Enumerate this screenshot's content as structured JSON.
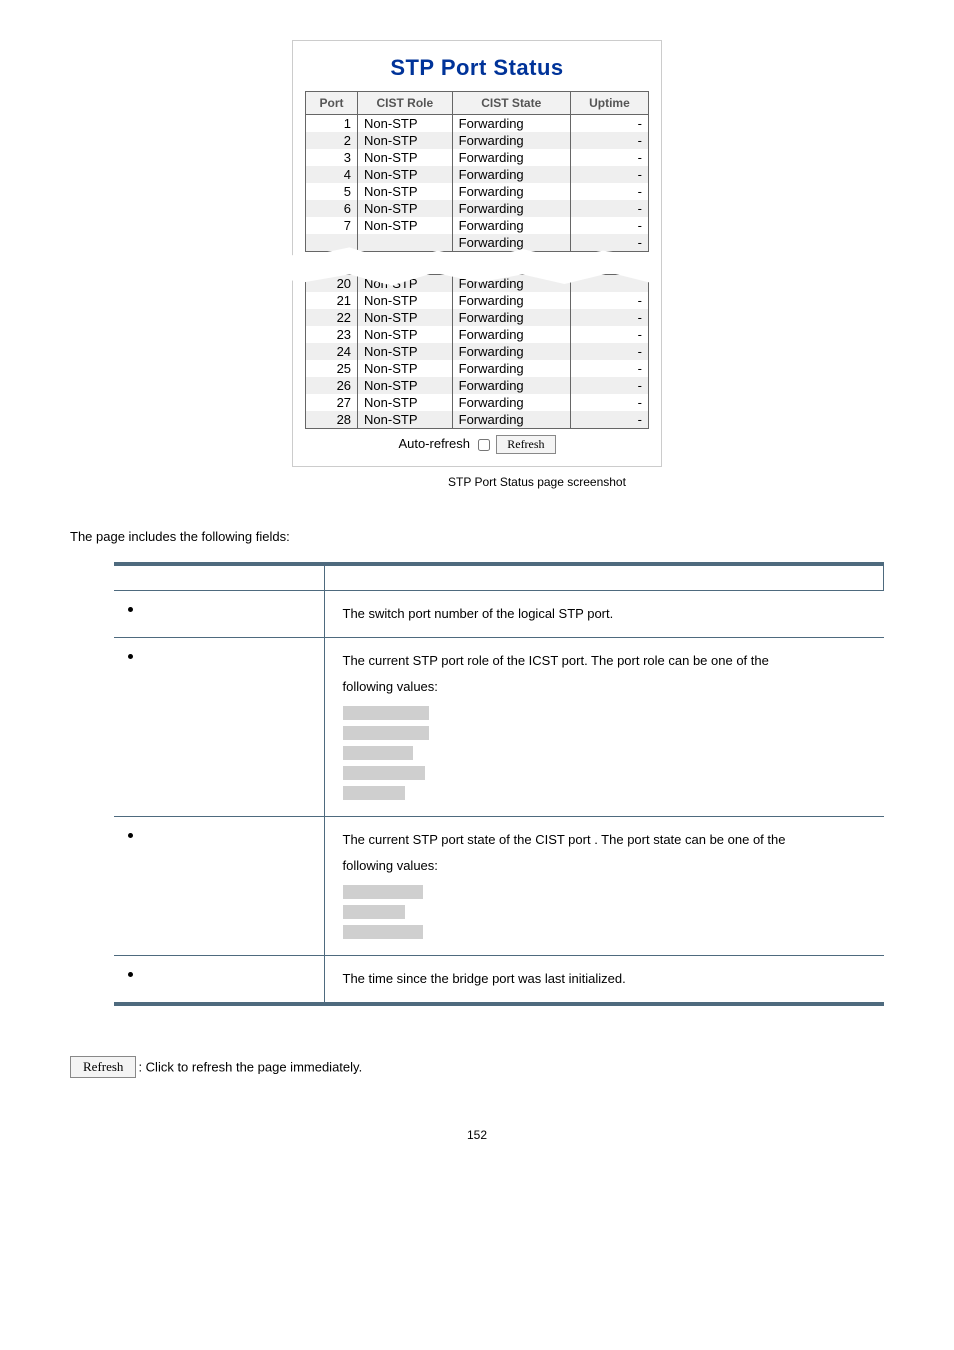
{
  "stp_panel": {
    "title": "STP Port Status",
    "headers": {
      "port": "Port",
      "cist_role": "CIST Role",
      "cist_state": "CIST State",
      "uptime": "Uptime"
    },
    "top_rows": [
      {
        "port": "1",
        "role": "Non-STP",
        "state": "Forwarding",
        "uptime": "-"
      },
      {
        "port": "2",
        "role": "Non-STP",
        "state": "Forwarding",
        "uptime": "-"
      },
      {
        "port": "3",
        "role": "Non-STP",
        "state": "Forwarding",
        "uptime": "-"
      },
      {
        "port": "4",
        "role": "Non-STP",
        "state": "Forwarding",
        "uptime": "-"
      },
      {
        "port": "5",
        "role": "Non-STP",
        "state": "Forwarding",
        "uptime": "-"
      },
      {
        "port": "6",
        "role": "Non-STP",
        "state": "Forwarding",
        "uptime": "-"
      },
      {
        "port": "7",
        "role": "Non-STP",
        "state": "Forwarding",
        "uptime": "-"
      },
      {
        "port": "",
        "role": "",
        "state": "Forwarding",
        "uptime": "-"
      }
    ],
    "bottom_rows": [
      {
        "port": "20",
        "role": "Non-STP",
        "state": "Forwarding",
        "uptime": ""
      },
      {
        "port": "21",
        "role": "Non-STP",
        "state": "Forwarding",
        "uptime": "-"
      },
      {
        "port": "22",
        "role": "Non-STP",
        "state": "Forwarding",
        "uptime": "-"
      },
      {
        "port": "23",
        "role": "Non-STP",
        "state": "Forwarding",
        "uptime": "-"
      },
      {
        "port": "24",
        "role": "Non-STP",
        "state": "Forwarding",
        "uptime": "-"
      },
      {
        "port": "25",
        "role": "Non-STP",
        "state": "Forwarding",
        "uptime": "-"
      },
      {
        "port": "26",
        "role": "Non-STP",
        "state": "Forwarding",
        "uptime": "-"
      },
      {
        "port": "27",
        "role": "Non-STP",
        "state": "Forwarding",
        "uptime": "-"
      },
      {
        "port": "28",
        "role": "Non-STP",
        "state": "Forwarding",
        "uptime": "-"
      }
    ],
    "auto_refresh_label": "Auto-refresh",
    "refresh_btn": "Refresh"
  },
  "caption": "STP Port Status page screenshot",
  "fields_intro": "The page includes the following fields:",
  "fields": {
    "port_desc": "The switch port number of the logical STP port.",
    "cist_role_desc_line1": "The current STP port role of the ICST port. The port role can be one of the",
    "cist_role_desc_line2": "following values:",
    "cist_state_desc_line1": "The current STP port state of the CIST port . The port state can be one of the",
    "cist_state_desc_line2": "following values:",
    "uptime_desc": "The time since the bridge port was last initialized."
  },
  "refresh_button_label": "Refresh",
  "refresh_note_text": ": Click to refresh the page immediately.",
  "page_number": "152"
}
